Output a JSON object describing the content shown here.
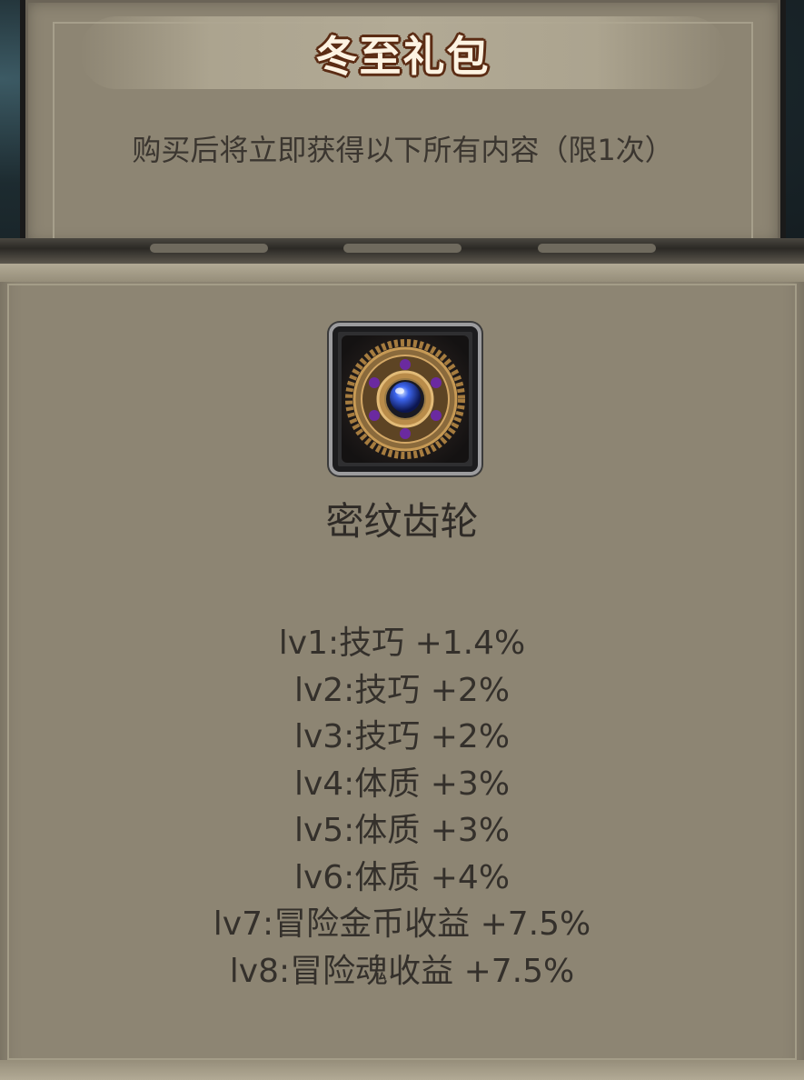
{
  "header": {
    "title": "冬至礼包",
    "subtitle": "购买后将立即获得以下所有内容（限1次）"
  },
  "item": {
    "icon": "gear-gem-icon",
    "name": "密纹齿轮",
    "levels": [
      "lv1:技巧 +1.4%",
      "lv2:技巧 +2%",
      "lv3:技巧 +2%",
      "lv4:体质 +3%",
      "lv5:体质 +3%",
      "lv6:体质 +4%",
      "lv7:冒险金币收益 +7.5%",
      "lv8:冒险魂收益 +7.5%"
    ]
  },
  "colors": {
    "panel": "#8d8573",
    "title_fill": "#fdf3e2",
    "title_outline": "#5b2c14",
    "text": "#34302b",
    "gem": "#2a4fd8"
  }
}
